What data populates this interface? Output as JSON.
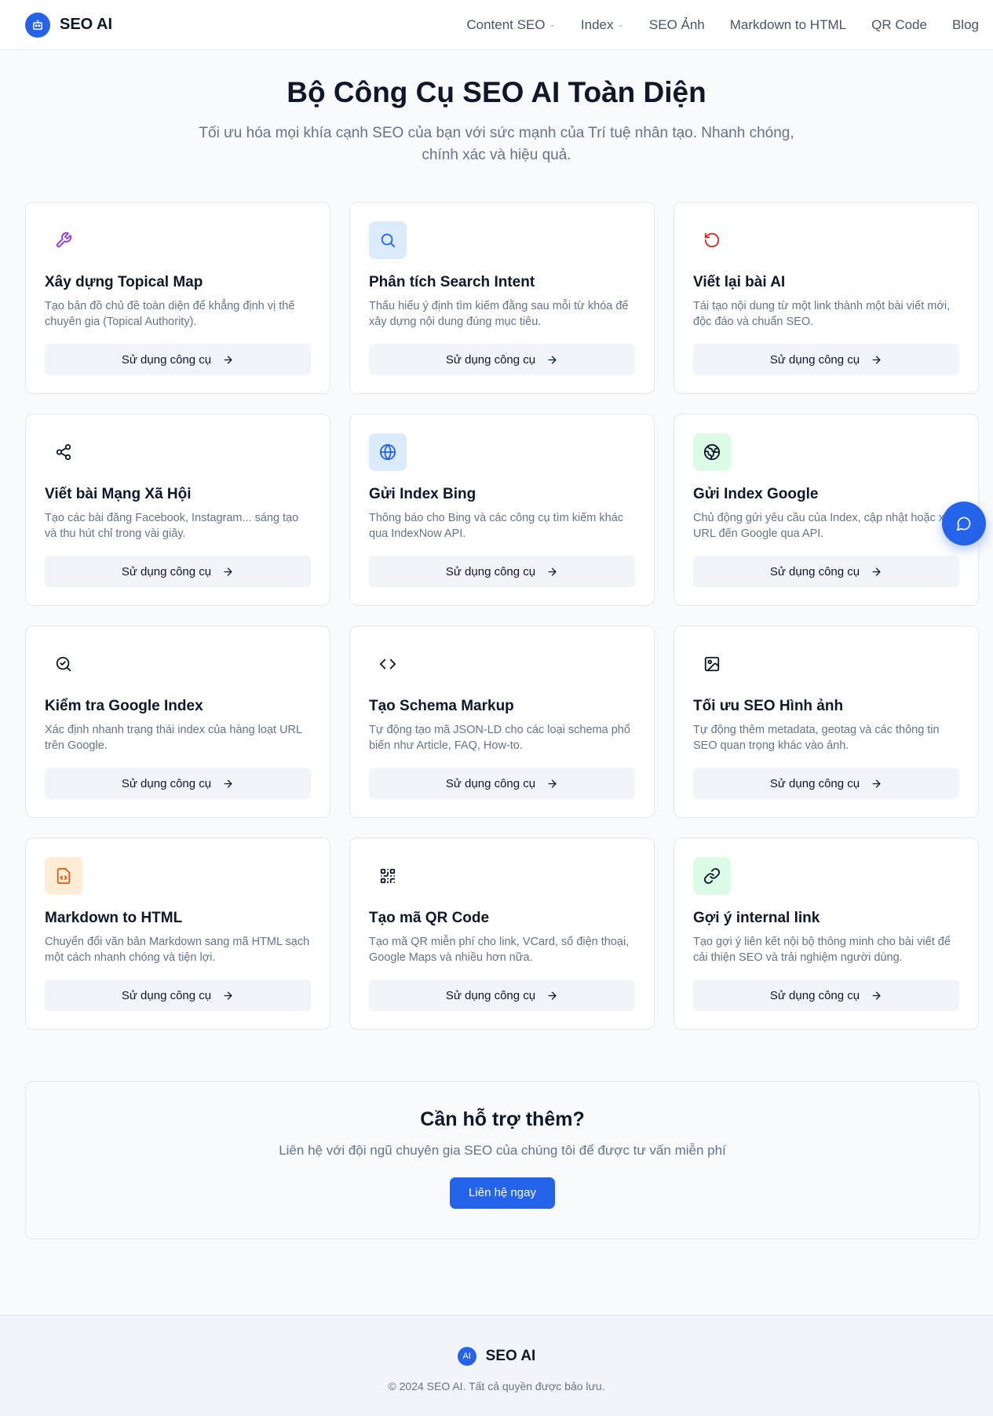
{
  "header": {
    "brand": "SEO AI",
    "nav": [
      {
        "label": "Content SEO",
        "dropdown": true
      },
      {
        "label": "Index",
        "dropdown": true
      },
      {
        "label": "SEO Ảnh",
        "dropdown": false
      },
      {
        "label": "Markdown to HTML",
        "dropdown": false
      },
      {
        "label": "QR Code",
        "dropdown": false
      },
      {
        "label": "Blog",
        "dropdown": false
      }
    ]
  },
  "hero": {
    "title": "Bộ Công Cụ SEO AI Toàn Diện",
    "subtitle": "Tối ưu hóa mọi khía cạnh SEO của bạn với sức mạnh của Trí tuệ nhân tạo. Nhanh chóng, chính xác và hiệu quả."
  },
  "cards": [
    {
      "icon": "wrench-icon",
      "icon_bg": "#ffffff",
      "icon_color": "#9333ea",
      "title": "Xây dựng Topical Map",
      "desc": "Tạo bản đồ chủ đề toàn diện để khẳng định vị thế chuyên gia (Topical Authority).",
      "button": "Sử dụng công cụ"
    },
    {
      "icon": "search-icon",
      "icon_bg": "#dbeafe",
      "icon_color": "#2563eb",
      "title": "Phân tích Search Intent",
      "desc": "Thấu hiểu ý định tìm kiếm đằng sau mỗi từ khóa để xây dựng nội dung đúng mục tiêu.",
      "button": "Sử dụng công cụ"
    },
    {
      "icon": "rotate-icon",
      "icon_bg": "#ffffff",
      "icon_color": "#dc2626",
      "title": "Viết lại bài AI",
      "desc": "Tái tạo nội dung từ một link thành một bài viết mới, độc đáo và chuẩn SEO.",
      "button": "Sử dụng công cụ"
    },
    {
      "icon": "share-icon",
      "icon_bg": "#ffffff",
      "icon_color": "#0f172a",
      "title": "Viết bài Mạng Xã Hội",
      "desc": "Tạo các bài đăng Facebook, Instagram... sáng tạo và thu hút chỉ trong vài giây.",
      "button": "Sử dụng công cụ"
    },
    {
      "icon": "globe-icon",
      "icon_bg": "#dbeafe",
      "icon_color": "#2563eb",
      "title": "Gửi Index Bing",
      "desc": "Thông báo cho Bing và các công cụ tìm kiếm khác qua IndexNow API.",
      "button": "Sử dụng công cụ"
    },
    {
      "icon": "earth-icon",
      "icon_bg": "#dcfce7",
      "icon_color": "#0f172a",
      "title": "Gửi Index Google",
      "desc": "Chủ động gửi yêu cầu của Index, cập nhật hoặc xóa URL đến Google qua API.",
      "button": "Sử dụng công cụ"
    },
    {
      "icon": "search-check-icon",
      "icon_bg": "#ffffff",
      "icon_color": "#0f172a",
      "title": "Kiểm tra Google Index",
      "desc": "Xác định nhanh trạng thái index của hàng loạt URL trên Google.",
      "button": "Sử dụng công cụ"
    },
    {
      "icon": "code-icon",
      "icon_bg": "#ffffff",
      "icon_color": "#0f172a",
      "title": "Tạo Schema Markup",
      "desc": "Tự động tạo mã JSON-LD cho các loại schema phổ biến như Article, FAQ, How-to.",
      "button": "Sử dụng công cụ"
    },
    {
      "icon": "image-icon",
      "icon_bg": "#ffffff",
      "icon_color": "#0f172a",
      "title": "Tối ưu SEO Hình ảnh",
      "desc": "Tự động thêm metadata, geotag và các thông tin SEO quan trọng khác vào ảnh.",
      "button": "Sử dụng công cụ"
    },
    {
      "icon": "file-code-icon",
      "icon_bg": "#ffedd5",
      "icon_color": "#ea580c",
      "title": "Markdown to HTML",
      "desc": "Chuyển đổi văn bản Markdown sang mã HTML sạch một cách nhanh chóng và tiện lợi.",
      "button": "Sử dụng công cụ"
    },
    {
      "icon": "qr-code-icon",
      "icon_bg": "#ffffff",
      "icon_color": "#0f172a",
      "title": "Tạo mã QR Code",
      "desc": "Tạo mã QR miễn phí cho link, VCard, số điện thoại, Google Maps và nhiều hơn nữa.",
      "button": "Sử dụng công cụ"
    },
    {
      "icon": "link-icon",
      "icon_bg": "#dcfce7",
      "icon_color": "#0f172a",
      "title": "Gợi ý internal link",
      "desc": "Tạo gợi ý liên kết nội bộ thông minh cho bài viết để cải thiện SEO và trải nghiệm người dùng.",
      "button": "Sử dụng công cụ"
    }
  ],
  "cta": {
    "title": "Cần hỗ trợ thêm?",
    "subtitle": "Liên hệ với đội ngũ chuyên gia SEO của chúng tôi để được tư vấn miễn phí",
    "button": "Liên hệ ngay"
  },
  "footer": {
    "logo_text": "AI",
    "brand": "SEO AI",
    "copyright": "© 2024 SEO AI. Tất cả quyền được bảo lưu."
  },
  "colors": {
    "accent": "#2563eb",
    "background": "#f8fafc"
  }
}
